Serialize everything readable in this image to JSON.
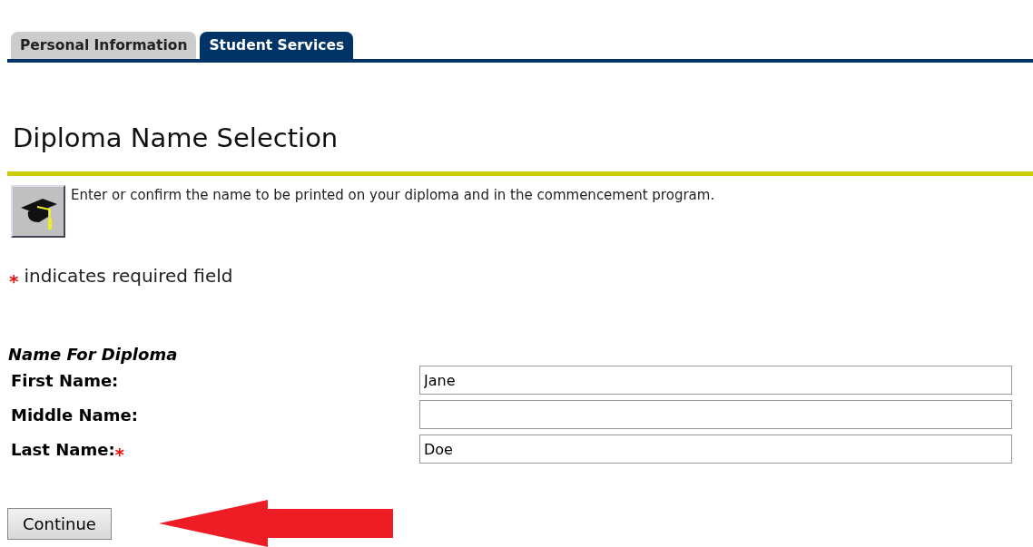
{
  "tabs": [
    {
      "label": "Personal Information",
      "selected": false
    },
    {
      "label": "Student Services",
      "selected": true
    }
  ],
  "page_title": "Diploma Name Selection",
  "info_text": "Enter or confirm the name to be printed on your diploma and in the commencement program.",
  "required_note": {
    "mark": "*",
    "text": "indicates required field"
  },
  "form": {
    "heading": "Name For Diploma",
    "fields": [
      {
        "label": "First Name:",
        "value": "Jane"
      },
      {
        "label": "Middle Name:"
      },
      {
        "label": "Last Name:",
        "value": "Doe",
        "mark": "*"
      }
    ]
  },
  "button": "Continue"
}
